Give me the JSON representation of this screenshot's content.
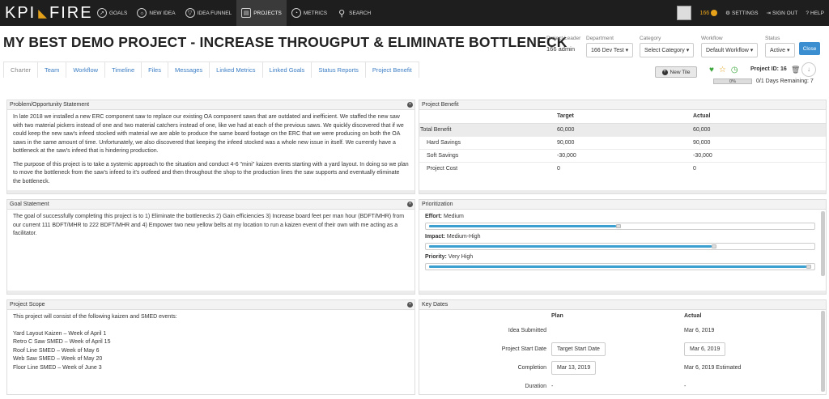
{
  "nav": {
    "logo_left": "KPI",
    "logo_right": "FIRE",
    "items": [
      {
        "label": "Goals",
        "icon": "compass-icon"
      },
      {
        "label": "New Idea",
        "icon": "lightbulb-icon"
      },
      {
        "label": "Idea Funnel",
        "icon": "funnel-icon"
      },
      {
        "label": "Projects",
        "icon": "projects-icon"
      },
      {
        "label": "Metrics",
        "icon": "speedometer-icon"
      },
      {
        "label": "Search",
        "icon": "search-icon"
      }
    ],
    "points": "166",
    "settings": "Settings",
    "signout": "Sign Out",
    "help": "Help"
  },
  "header": {
    "title": "MY BEST DEMO PROJECT - INCREASE THROUGPUT & ELIMINATE BOTTLENECK",
    "project_leader_label": "Project Leader",
    "project_leader": "166 admin",
    "department_label": "Department",
    "department": "166 Dev Test ▾",
    "category_label": "Category",
    "category": "Select Category ▾",
    "workflow_label": "Workflow",
    "workflow": "Default Workflow ▾",
    "status_label": "Status",
    "status": "Active ▾",
    "close": "Close"
  },
  "tabs": [
    "Charter",
    "Team",
    "Workflow",
    "Timeline",
    "Files",
    "Messages",
    "Linked Metrics",
    "Linked Goals",
    "Status Reports",
    "Project Benefit"
  ],
  "toolbar": {
    "new_tile": "New Tile",
    "project_id": "Project ID: 16",
    "progress": "0%",
    "progress_value": 0,
    "remaining": "0/1  Days Remaining: 7"
  },
  "problem": {
    "title": "Problem/Opportunity Statement",
    "p1": "In late 2018 we installed a new ERC component saw to replace our existing OA component saws that are outdated and inefficient. We staffed the new saw with two material pickers instead of one and two material catchers instead of one, like we had at each of the previous saws. We quickly discovered that if we could keep the new saw's infeed stocked with material we are able to produce the same board footage on the ERC that we were producing on both the OA saws in the same amount of time. Unfortunately, we also discovered that keeping the infeed stocked was a whole new issue in itself. We currently have a bottleneck at the saw's infeed that is hindering production.",
    "p2": "The purpose of this project is to take a systemic approach to the situation and conduct 4-6 \"mini\" kaizen events starting with a yard layout. In doing so we plan to move the bottleneck from the saw's infeed to it's outfeed and then throughout the shop to the production lines the saw supports and eventually eliminate the bottleneck."
  },
  "benefit": {
    "title": "Project Benefit",
    "col_target": "Target",
    "col_actual": "Actual",
    "rows": [
      {
        "label": "Total Benefit",
        "target": "60,000",
        "actual": "60,000"
      },
      {
        "label": "Hard Savings",
        "target": "90,000",
        "actual": "90,000"
      },
      {
        "label": "Soft Savings",
        "target": "-30,000",
        "actual": "-30,000"
      },
      {
        "label": "Project Cost",
        "target": "0",
        "actual": "0"
      }
    ]
  },
  "goal": {
    "title": "Goal Statement",
    "text": "The goal of successfully completing this project is to 1) Eliminate the bottlenecks 2) Gain efficiencies 3) Increase board feet per man hour (BDFT/MHR) from our current 111 BDFT/MHR to 222 BDFT/MHR and 4) Empower two new yellow belts at my location to run a kaizen event of their own with me acting as a facilitator."
  },
  "prioritization": {
    "title": "Prioritization",
    "effort_label": "Effort:",
    "effort_value": "Medium",
    "effort_level": 0.5,
    "impact_label": "Impact:",
    "impact_value": "Medium-High",
    "impact_level": 0.75,
    "priority_label": "Priority:",
    "priority_value": "Very High",
    "priority_level": 1.0
  },
  "scope": {
    "title": "Project Scope",
    "intro": "This project will consist of the following kaizen and SMED events:",
    "items": [
      "Yard Layout Kaizen – Week of April 1",
      "Retro C Saw SMED – Week of April 15",
      "Roof Line SMED – Week of May 6",
      "Web Saw SMED – Week of May 20",
      "Floor Line SMED – Week of June 3"
    ]
  },
  "keydates": {
    "title": "Key Dates",
    "col_plan": "Plan",
    "col_actual": "Actual",
    "rows": [
      {
        "label": "Idea Submitted",
        "plan": "",
        "actual": "Mar 6, 2019"
      },
      {
        "label": "Project Start Date",
        "plan": "Target Start Date",
        "actual": "Mar 6, 2019"
      },
      {
        "label": "Completion",
        "plan": "Mar 13, 2019",
        "actual": "Mar 6, 2019 Estimated"
      },
      {
        "label": "Duration",
        "plan": "-",
        "actual": "-"
      }
    ]
  },
  "colors": {
    "accent": "#e5a11a",
    "link": "#3b7dc4",
    "button": "#3b8fd1",
    "slider": "#3ba0cf"
  }
}
